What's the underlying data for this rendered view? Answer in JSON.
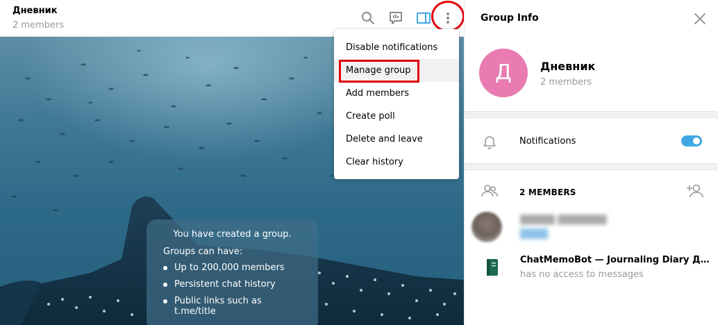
{
  "chat": {
    "title": "Дневник",
    "subtitle": "2 members",
    "header_icons": [
      "search-icon",
      "pinned-messages-icon",
      "sidebar-toggle-icon",
      "more-vertical-icon"
    ]
  },
  "service_message": {
    "title": "You have created a group.",
    "subtitle": "Groups can have:",
    "items": [
      "Up to 200,000 members",
      "Persistent chat history",
      "Public links such as t.me/title"
    ]
  },
  "menu": {
    "items": [
      "Disable notifications",
      "Manage group",
      "Add members",
      "Create poll",
      "Delete and leave",
      "Clear history"
    ],
    "highlighted": "Manage group"
  },
  "info": {
    "header_title": "Group Info",
    "avatar_letter": "Д",
    "avatar_color": "#e97ab2",
    "name": "Дневник",
    "members": "2 members",
    "notifications_label": "Notifications",
    "notifications_enabled": true,
    "members_header": "2 MEMBERS",
    "member_list": [
      {
        "name": "",
        "status": ""
      },
      {
        "name": "ChatMemoBot — Journaling Diary Дне...",
        "status": "has no access to messages"
      }
    ]
  },
  "colors": {
    "accent": "#40a7e3",
    "annotation": "#e0000b"
  }
}
